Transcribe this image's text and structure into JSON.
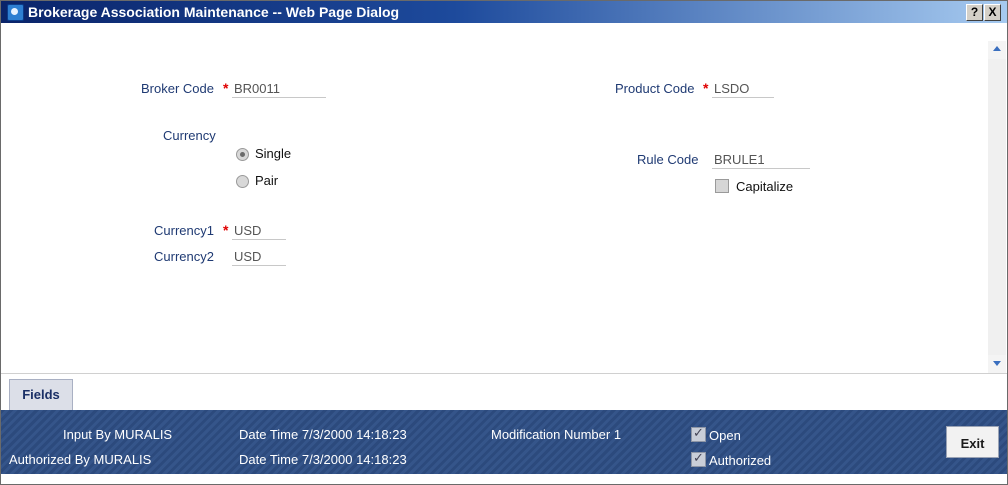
{
  "window": {
    "title": "Brokerage Association Maintenance -- Web Page Dialog",
    "help_label": "?",
    "close_label": "X"
  },
  "form": {
    "broker_code": {
      "label": "Broker Code",
      "required": "*",
      "value": "BR0011"
    },
    "product_code": {
      "label": "Product Code",
      "required": "*",
      "value": "LSDO"
    },
    "currency": {
      "label": "Currency",
      "options": [
        {
          "label": "Single",
          "selected": true
        },
        {
          "label": "Pair",
          "selected": false
        }
      ]
    },
    "rule_code": {
      "label": "Rule Code",
      "value": "BRULE1"
    },
    "capitalize": {
      "label": "Capitalize",
      "checked": false
    },
    "currency1": {
      "label": "Currency1",
      "required": "*",
      "value": "USD"
    },
    "currency2": {
      "label": "Currency2",
      "value": "USD"
    }
  },
  "tabs": {
    "fields": "Fields"
  },
  "audit": {
    "input_by": "Input By MURALIS",
    "input_datetime": "Date Time 7/3/2000 14:18:23",
    "authorized_by": "Authorized By MURALIS",
    "authorized_datetime": "Date Time 7/3/2000 14:18:23",
    "modification": "Modification Number 1",
    "open": {
      "label": "Open",
      "checked": true
    },
    "authorized": {
      "label": "Authorized",
      "checked": true
    }
  },
  "buttons": {
    "exit": "Exit"
  },
  "colors": {
    "title_bar": "#0a246a",
    "footer": "#2c4a7d",
    "required": "#e00000",
    "label": "#1f3a73"
  }
}
